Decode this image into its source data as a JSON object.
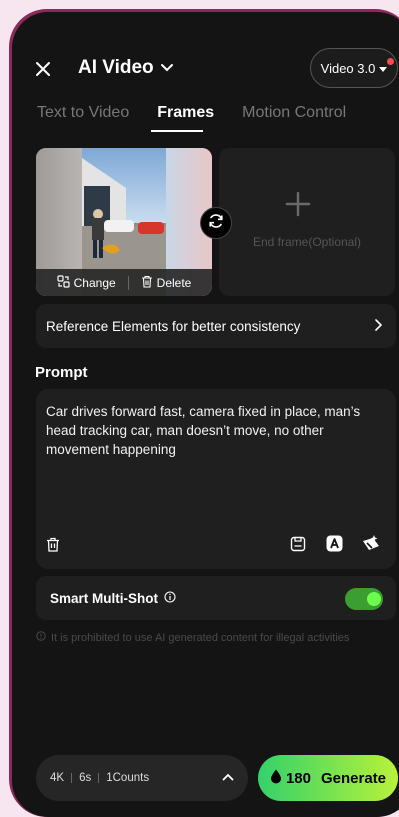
{
  "header": {
    "title": "AI Video",
    "version_label": "Video 3.0"
  },
  "tabs": [
    {
      "label": "Text to Video",
      "active": false
    },
    {
      "label": "Frames",
      "active": true
    },
    {
      "label": "Motion Control",
      "active": false
    }
  ],
  "frames": {
    "start": {
      "change_label": "Change",
      "delete_label": "Delete"
    },
    "end": {
      "placeholder": "End frame(Optional)"
    }
  },
  "reference": {
    "label": "Reference Elements for better consistency"
  },
  "prompt": {
    "label": "Prompt",
    "text": "Car drives forward fast, camera fixed in place, man’s head tracking car, man doesn’t move, no other movement happening"
  },
  "smart_multishot": {
    "label": "Smart Multi-Shot",
    "enabled": true
  },
  "disclaimer": "It is prohibited to use AI generated content for illegal activities",
  "bottom": {
    "resolution": "4K",
    "duration": "6s",
    "counts": "1Counts",
    "credits": "180",
    "generate_label": "Generate"
  },
  "colors": {
    "accent_green": "#6cff4c",
    "generate_gradient_start": "#33d16b",
    "generate_gradient_end": "#b8f23a",
    "notification_dot": "#ff4d4d"
  }
}
